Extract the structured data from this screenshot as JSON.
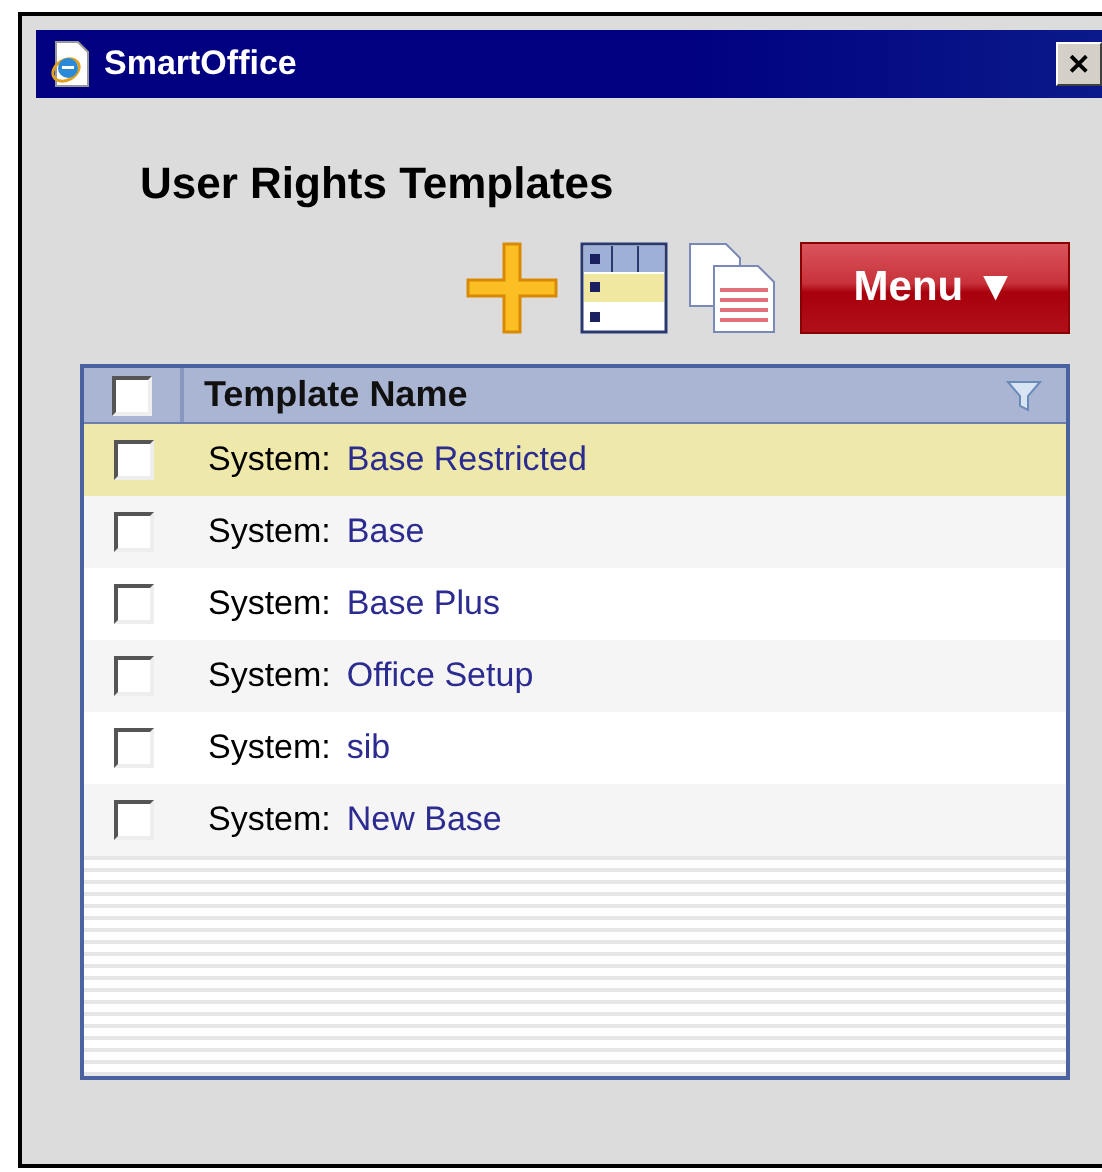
{
  "window": {
    "title": "SmartOffice",
    "close": "✕"
  },
  "heading": "User Rights Templates",
  "menu_button": {
    "label": "Menu",
    "caret": "▼"
  },
  "table": {
    "select_all_checked": false,
    "column": "Template Name",
    "rows": [
      {
        "prefix": "System:",
        "name": "Base Restricted",
        "selected": true,
        "checked": false
      },
      {
        "prefix": "System:",
        "name": "Base",
        "selected": false,
        "checked": false
      },
      {
        "prefix": "System:",
        "name": "Base Plus",
        "selected": false,
        "checked": false
      },
      {
        "prefix": "System:",
        "name": "Office Setup",
        "selected": false,
        "checked": false
      },
      {
        "prefix": "System:",
        "name": "sib",
        "selected": false,
        "checked": false
      },
      {
        "prefix": "System:",
        "name": "New Base",
        "selected": false,
        "checked": false
      }
    ]
  }
}
